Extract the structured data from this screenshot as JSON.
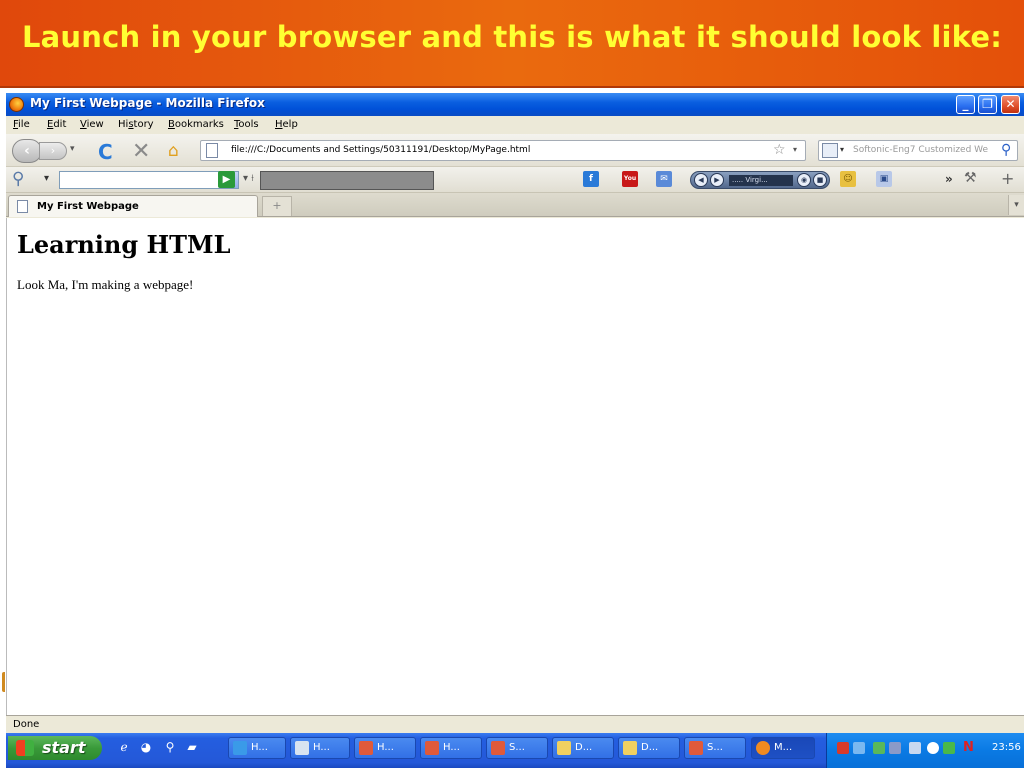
{
  "slide": {
    "title": "Launch in your browser and this is what it should look like:"
  },
  "window": {
    "title": "My First Webpage - Mozilla Firefox",
    "controls": {
      "minimize": "_",
      "maximize": "❐",
      "close": "✕"
    }
  },
  "menu": {
    "items": [
      {
        "mnemonic": "F",
        "rest": "ile"
      },
      {
        "mnemonic": "E",
        "rest": "dit"
      },
      {
        "mnemonic": "V",
        "rest": "iew"
      },
      {
        "pre": "Hi",
        "mnemonic": "s",
        "rest": "tory"
      },
      {
        "mnemonic": "B",
        "rest": "ookmarks"
      },
      {
        "mnemonic": "T",
        "rest": "ools"
      },
      {
        "mnemonic": "H",
        "rest": "elp"
      }
    ]
  },
  "navigation": {
    "url": "file:///C:/Documents and Settings/50311191/Desktop/MyPage.html",
    "search_placeholder": "Softonic-Eng7 Customized We"
  },
  "toolbar": {
    "media_label": "..... Virgi...",
    "more": "»"
  },
  "tabs": [
    {
      "label": "My First Webpage"
    }
  ],
  "page": {
    "heading": "Learning HTML",
    "paragraph": "Look Ma, I'm making a webpage!"
  },
  "status": {
    "text": "Done"
  },
  "taskbar": {
    "start_label": "start",
    "buttons": [
      {
        "label": "H...",
        "icon": "ie-icon"
      },
      {
        "label": "H...",
        "icon": "notepad-icon"
      },
      {
        "label": "H...",
        "icon": "powerpoint-icon"
      },
      {
        "label": "H...",
        "icon": "powerpoint-icon"
      },
      {
        "label": "S...",
        "icon": "powerpoint-icon"
      },
      {
        "label": "D...",
        "icon": "folder-icon"
      },
      {
        "label": "D...",
        "icon": "folder-icon"
      },
      {
        "label": "S...",
        "icon": "powerpoint-icon"
      },
      {
        "label": "M...",
        "icon": "firefox-icon",
        "active": true
      }
    ],
    "clock": "23:56"
  },
  "colors": {
    "banner": "#e0480c",
    "banner_text": "#ffff33",
    "xp_blue": "#245ee0",
    "start_green": "#3a9a3a"
  }
}
